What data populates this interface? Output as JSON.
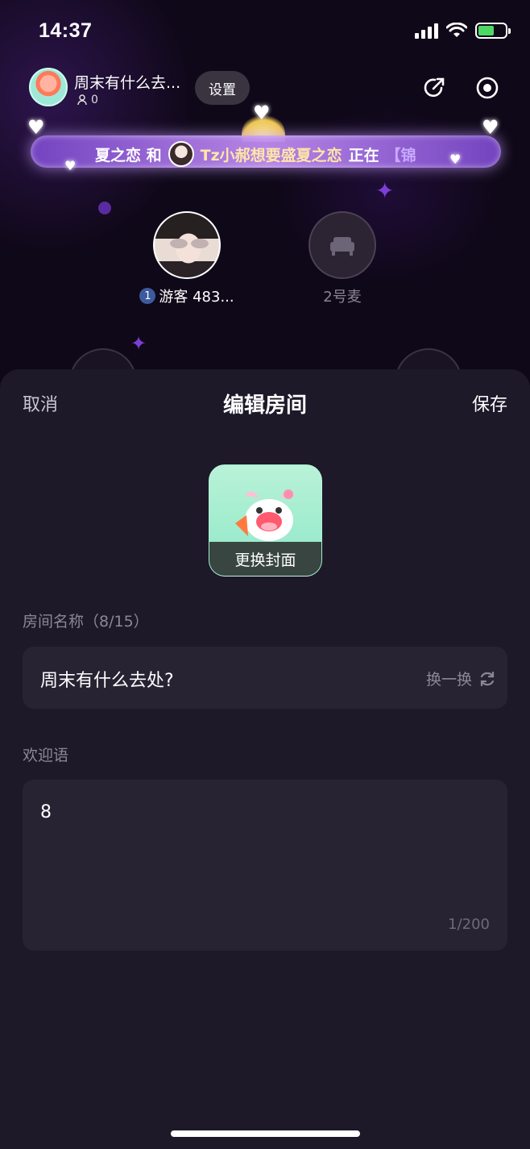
{
  "status_bar": {
    "time": "14:37"
  },
  "room": {
    "title": "周末有什么去...",
    "member_count": "0",
    "settings_label": "设置"
  },
  "banner": {
    "text_left": "夏之恋 和",
    "text_right_name": "Tz小郝想要盛夏之恋",
    "text_action": "正在",
    "text_tail": "【锦"
  },
  "mics": [
    {
      "badge": "1",
      "label": "游客 483..."
    },
    {
      "label": "2号麦"
    }
  ],
  "sheet": {
    "cancel": "取消",
    "title": "编辑房间",
    "save": "保存",
    "cover_label": "更换封面",
    "room_name_label": "房间名称（8/15）",
    "room_name_value": "周末有什么去处?",
    "shuffle_label": "换一换",
    "welcome_label": "欢迎语",
    "welcome_value": "8",
    "welcome_count": "1/200"
  },
  "colors": {
    "sheet_bg": "#1d1929",
    "field_bg": "#272333",
    "muted_text": "#8b8794"
  },
  "icons": [
    "user-icon",
    "share-icon",
    "record-icon",
    "sofa-icon",
    "refresh-icon",
    "wifi-icon",
    "signal-icon",
    "battery-icon"
  ]
}
